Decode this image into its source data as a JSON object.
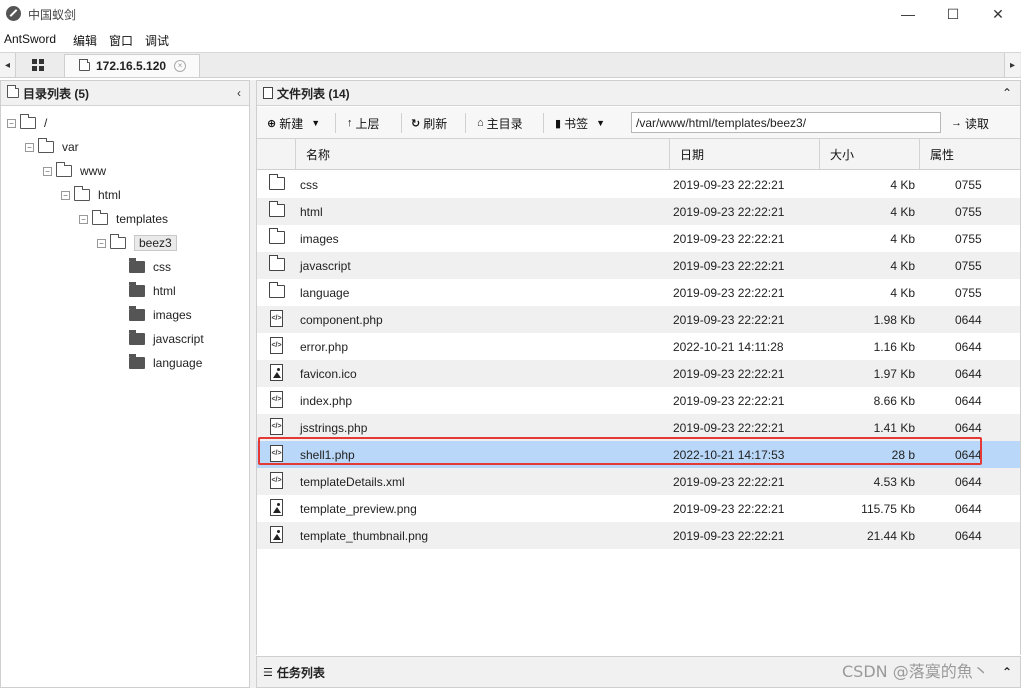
{
  "window": {
    "title": "中国蚁剑",
    "minimize": "—",
    "maximize": "☐",
    "close": "✕"
  },
  "menu": [
    "AntSword",
    "编辑",
    "窗口",
    "调试"
  ],
  "tabs": {
    "host": "172.16.5.120",
    "close": "×",
    "left_arrow": "◂",
    "right_arrow": "▸"
  },
  "left_panel": {
    "title": "目录列表 (5)",
    "collapse": "‹",
    "tree": [
      {
        "label": "/",
        "level": 0,
        "type": "open"
      },
      {
        "label": "var",
        "level": 1,
        "type": "open"
      },
      {
        "label": "www",
        "level": 2,
        "type": "open"
      },
      {
        "label": "html",
        "level": 3,
        "type": "open"
      },
      {
        "label": "templates",
        "level": 4,
        "type": "open"
      },
      {
        "label": "beez3",
        "level": 5,
        "type": "open"
      },
      {
        "label": "css",
        "level": 6,
        "type": "leaf"
      },
      {
        "label": "html",
        "level": 6,
        "type": "leaf"
      },
      {
        "label": "images",
        "level": 6,
        "type": "leaf"
      },
      {
        "label": "javascript",
        "level": 6,
        "type": "leaf"
      },
      {
        "label": "language",
        "level": 6,
        "type": "leaf"
      }
    ]
  },
  "right_panel": {
    "title": "文件列表 (14)",
    "collapse": "⌃",
    "toolbar": {
      "new": "新建",
      "up": "上层",
      "refresh": "刷新",
      "home": "主目录",
      "bookmark": "书签",
      "read": "读取"
    },
    "path": "/var/www/html/templates/beez3/",
    "columns": {
      "name": "名称",
      "date": "日期",
      "size": "大小",
      "attr": "属性"
    },
    "files": [
      {
        "name": "css",
        "date": "2019-09-23 22:22:21",
        "size": "4 Kb",
        "attr": "0755",
        "kind": "folder"
      },
      {
        "name": "html",
        "date": "2019-09-23 22:22:21",
        "size": "4 Kb",
        "attr": "0755",
        "kind": "folder"
      },
      {
        "name": "images",
        "date": "2019-09-23 22:22:21",
        "size": "4 Kb",
        "attr": "0755",
        "kind": "folder"
      },
      {
        "name": "javascript",
        "date": "2019-09-23 22:22:21",
        "size": "4 Kb",
        "attr": "0755",
        "kind": "folder"
      },
      {
        "name": "language",
        "date": "2019-09-23 22:22:21",
        "size": "4 Kb",
        "attr": "0755",
        "kind": "folder"
      },
      {
        "name": "component.php",
        "date": "2019-09-23 22:22:21",
        "size": "1.98 Kb",
        "attr": "0644",
        "kind": "code"
      },
      {
        "name": "error.php",
        "date": "2022-10-21 14:11:28",
        "size": "1.16 Kb",
        "attr": "0644",
        "kind": "code"
      },
      {
        "name": "favicon.ico",
        "date": "2019-09-23 22:22:21",
        "size": "1.97 Kb",
        "attr": "0644",
        "kind": "image"
      },
      {
        "name": "index.php",
        "date": "2019-09-23 22:22:21",
        "size": "8.66 Kb",
        "attr": "0644",
        "kind": "code"
      },
      {
        "name": "jsstrings.php",
        "date": "2019-09-23 22:22:21",
        "size": "1.41 Kb",
        "attr": "0644",
        "kind": "code"
      },
      {
        "name": "shell1.php",
        "date": "2022-10-21 14:17:53",
        "size": "28 b",
        "attr": "0644",
        "kind": "code",
        "selected": true
      },
      {
        "name": "templateDetails.xml",
        "date": "2019-09-23 22:22:21",
        "size": "4.53 Kb",
        "attr": "0644",
        "kind": "code"
      },
      {
        "name": "template_preview.png",
        "date": "2019-09-23 22:22:21",
        "size": "115.75 Kb",
        "attr": "0644",
        "kind": "image"
      },
      {
        "name": "template_thumbnail.png",
        "date": "2019-09-23 22:22:21",
        "size": "21.44 Kb",
        "attr": "0644",
        "kind": "image"
      }
    ]
  },
  "task_panel": {
    "title": "任务列表",
    "collapse": "⌃"
  },
  "watermark": "CSDN @落寞的魚丶",
  "colors": {
    "selected_row": "#b9d7f8",
    "highlight": "#e53935"
  }
}
